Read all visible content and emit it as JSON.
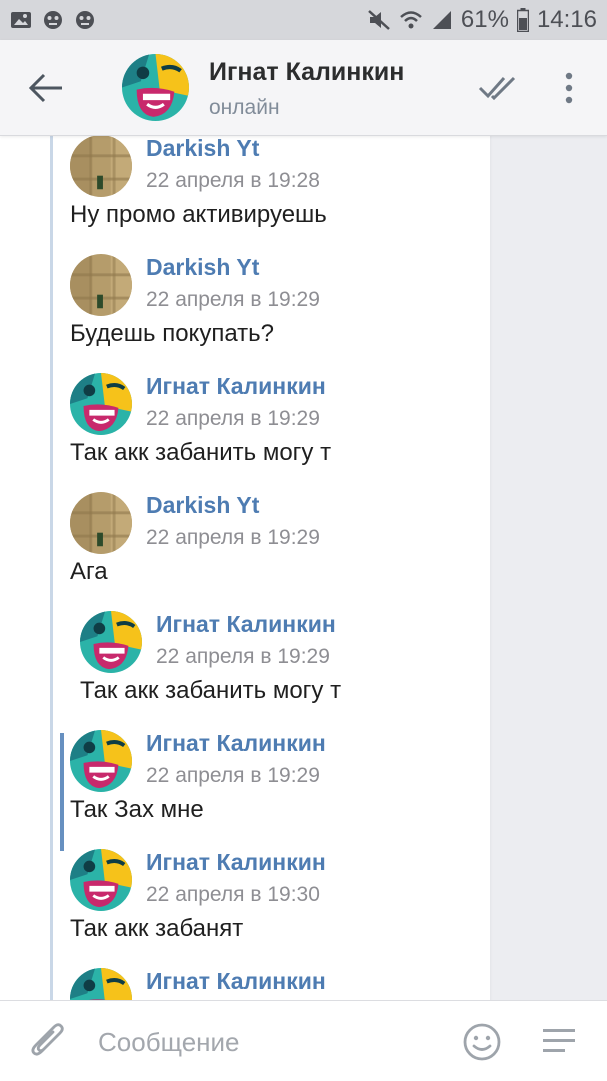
{
  "status_bar": {
    "battery": "61%",
    "time": "14:16",
    "icons": [
      "gallery-icon",
      "app-icon",
      "app-icon",
      "mute-icon",
      "wifi-icon",
      "signal-icon",
      "battery-icon"
    ]
  },
  "header": {
    "name": "Игнат Калинкин",
    "status": "онлайн",
    "icons": [
      "back-arrow-icon",
      "double-check-icon",
      "more-vertical-icon"
    ]
  },
  "messages": [
    {
      "author": "Darkish Yt",
      "date": "22 апреля в 19:28",
      "text": "Ну промо активируешь"
    },
    {
      "author": "Darkish Yt",
      "date": "22 апреля в 19:29",
      "text": "Будешь покупать?"
    },
    {
      "author": "Игнат Калинкин",
      "date": "22 апреля в 19:29",
      "text": "Так акк забанить могу т"
    },
    {
      "author": "Darkish Yt",
      "date": "22 апреля в 19:29",
      "text": "Ага"
    },
    {
      "author": "Игнат Калинкин",
      "date": "22 апреля в 19:29",
      "text": "Так акк забанить могу т"
    },
    {
      "author": "Игнат Калинкин",
      "date": "22 апреля в 19:29",
      "text": "Так Зах мне"
    },
    {
      "author": "Игнат Калинкин",
      "date": "22 апреля в 19:30",
      "text": "Так акк забанят"
    },
    {
      "author": "Игнат Калинкин",
      "date": "",
      "text": ""
    }
  ],
  "input": {
    "placeholder": "Сообщение",
    "icons": [
      "attach-icon",
      "emoji-icon",
      "menu-icon"
    ]
  },
  "colors": {
    "link": "#4e7cb2",
    "header_bg": "#f5f5f7",
    "status_bar_bg": "#d6d7db",
    "page_bg": "#ecedf1",
    "forward_line": "#6790c0"
  }
}
